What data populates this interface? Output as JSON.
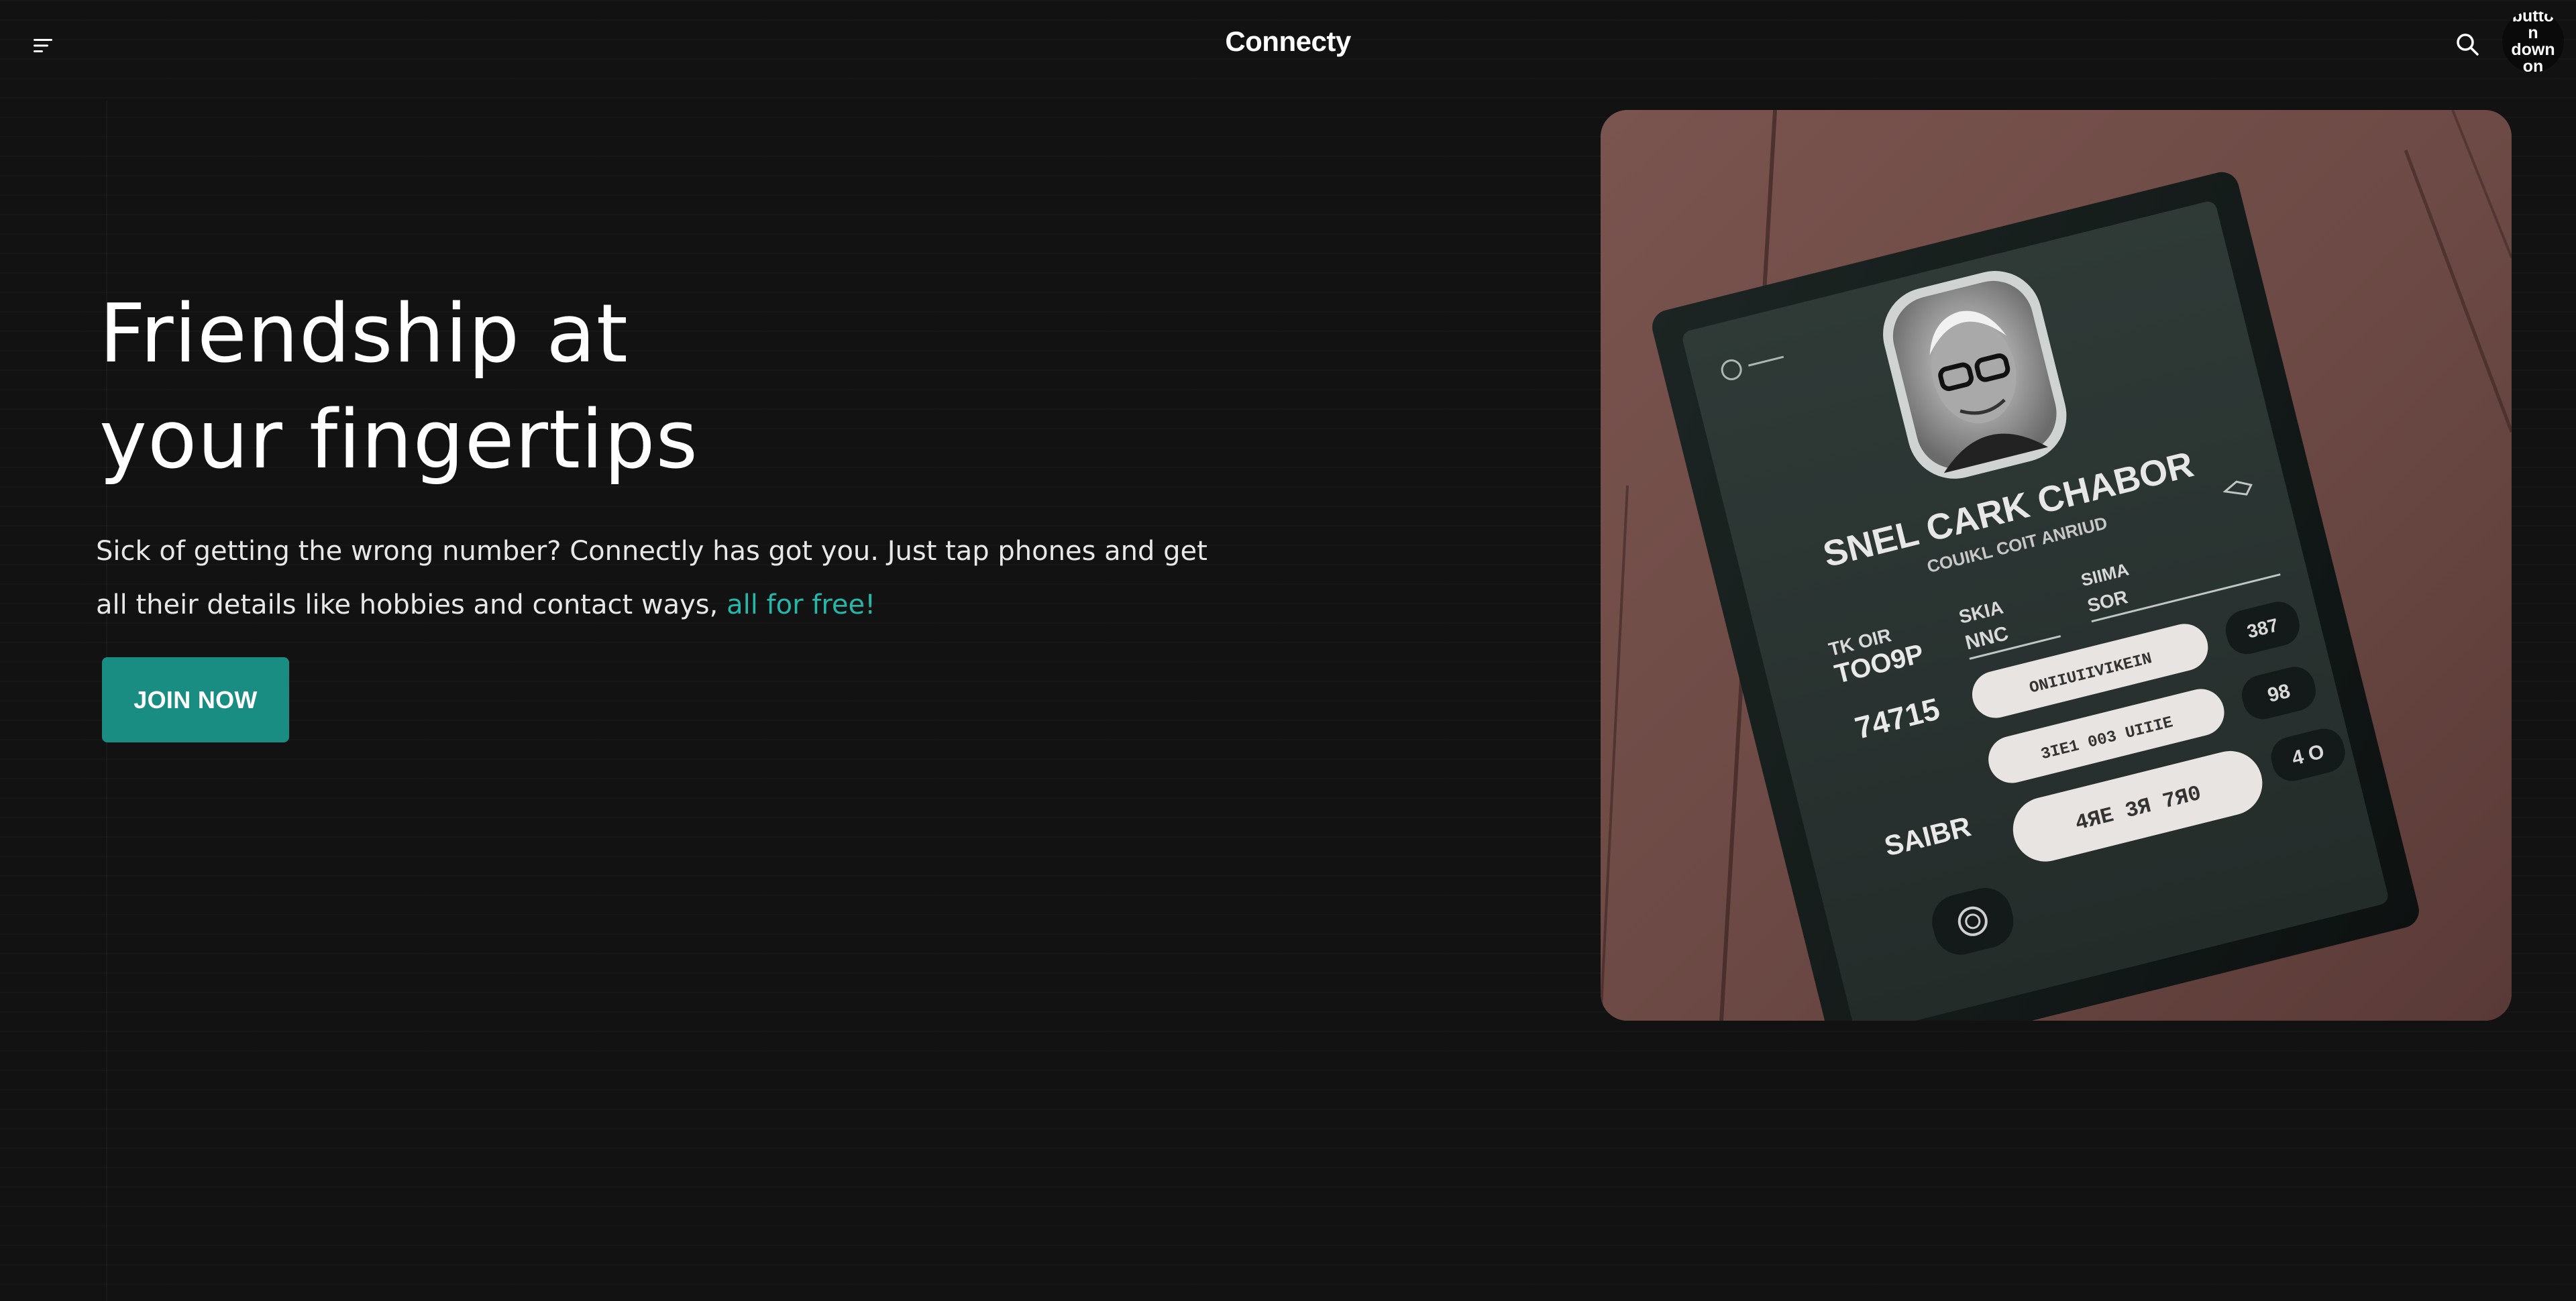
{
  "header": {
    "brand": "Connecty",
    "menu_icon": "menu-icon",
    "search_icon": "search-icon",
    "avatar_alt_text": "button down on"
  },
  "hero": {
    "title_line1": "Friendship at",
    "title_line2": "your fingertips",
    "description": "Sick of getting the wrong number? Connectly has got you. Just tap phones and get all their details like hobbies and contact ways, ",
    "description_highlight": "all for free!",
    "cta_label": "JOIN NOW"
  },
  "image_card": {
    "name": "SNEL CARK CHABOR",
    "subtitle": "COUIKL COIT ANRIUD",
    "label_left1_a": "TK OIR",
    "label_left1_b": "TOO9P",
    "label_mid_a": "SKIA",
    "label_mid_b": "NNC",
    "label_right_a": "SIIMA",
    "label_right_b": "SOR",
    "row1_num": "74715",
    "row1_field": "ONIIUIIVIKEIN",
    "row1_badge": "387",
    "row2_field": "3IE1 003 UIIIE",
    "row2_badge": "98",
    "row3_label": "SAIBR",
    "row3_field": "4ЯE 3Я 7Я0",
    "row3_badge": "4 O"
  },
  "colors": {
    "background": "#121212",
    "accent": "#1a8d82",
    "highlight_text": "#26b7a8",
    "card_backdrop": "#6e4a46"
  }
}
